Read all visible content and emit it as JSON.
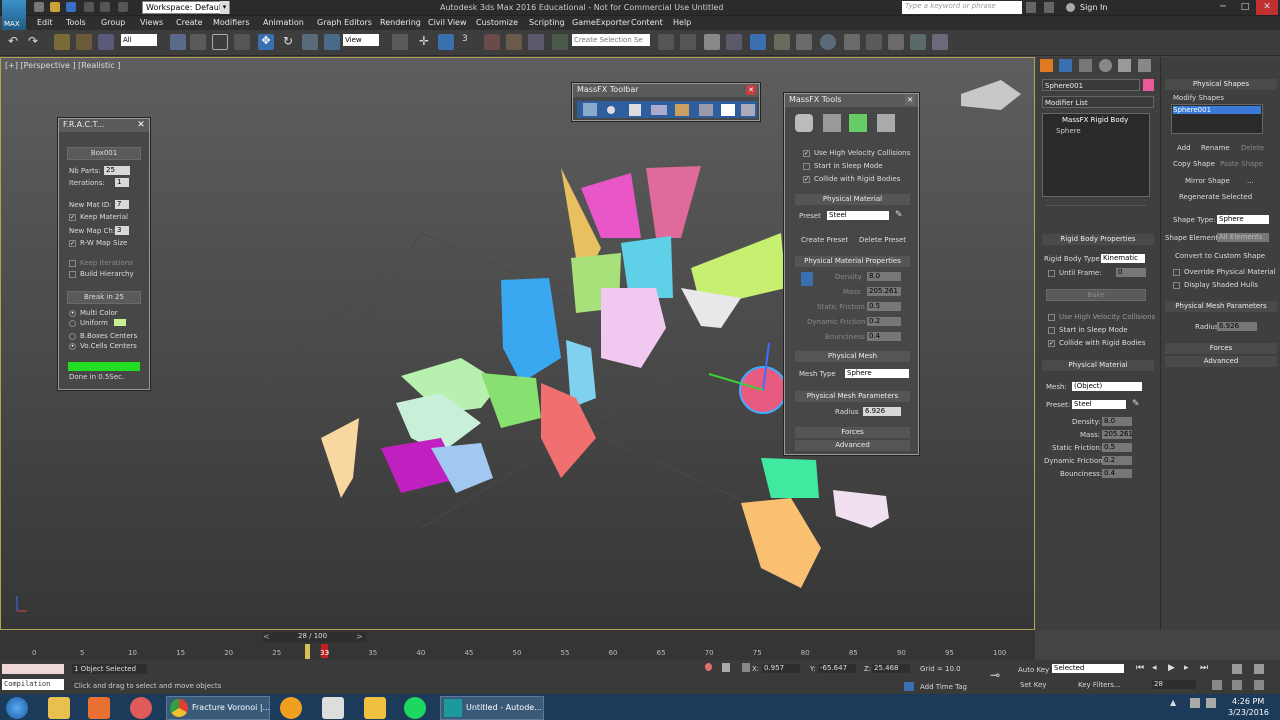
{
  "title_bar": {
    "workspace": "Workspace: Default",
    "title": "Autodesk 3ds Max 2016 Educational - Not for Commercial Use   Untitled",
    "search_placeholder": "Type a keyword or phrase",
    "sign_in": "Sign In",
    "logo": "MAX"
  },
  "menus": [
    "Edit",
    "Tools",
    "Group",
    "Views",
    "Create",
    "Modifiers",
    "Animation",
    "Graph Editors",
    "Rendering",
    "Civil View",
    "Customize",
    "Scripting",
    "GameExporter",
    "Content",
    "Help"
  ],
  "toolbar": {
    "filter": "All",
    "view": "View",
    "selection_set": "Create Selection Se"
  },
  "viewport": {
    "label": "[+] [Perspective ] [Realistic ]"
  },
  "fracture": {
    "title": "F.R.A.C.T...",
    "object": "Box001",
    "nb_parts_label": "Nb Parts:",
    "nb_parts": "25",
    "iterations_label": "Iterations:",
    "iterations": "1",
    "new_mat_id_label": "New Mat ID:",
    "new_mat_id": "7",
    "keep_material": "Keep Material",
    "new_map_ch_label": "New Map Ch:",
    "new_map_ch": "3",
    "rw_map_size": "R-W Map Size",
    "keep_iterations": "Keep Iterations",
    "build_hierarchy": "Build Hierarchy",
    "break_button": "Break in 25",
    "multi_color": "Multi Color",
    "uniform": "Uniform",
    "boxes_centers": "B.Boxes Centers",
    "vo_cells_centers": "Vo.Cells Centers",
    "done": "Done in 0.5Sec.",
    "progress": 1.0
  },
  "massfx_toolbar": {
    "title": "MassFX Toolbar"
  },
  "massfx_tools": {
    "title": "MassFX Tools",
    "use_high_velocity": "Use High Velocity Collisions",
    "start_sleep": "Start in Sleep Mode",
    "collide_rigid": "Collide with Rigid Bodies",
    "physical_material": "Physical Material",
    "preset_label": "Preset",
    "preset": "Steel",
    "create_preset": "Create Preset",
    "delete_preset": "Delete Preset",
    "pm_properties": "Physical Material Properties",
    "density_label": "Density",
    "density": "8.0",
    "mass_label": "Mass",
    "mass": "205.261",
    "static_friction_label": "Static Friction",
    "static_friction": "0.5",
    "dynamic_friction_label": "Dynamic Friction",
    "dynamic_friction": "0.2",
    "bounciness_label": "Bounciness",
    "bounciness": "0.4",
    "physical_mesh": "Physical Mesh",
    "mesh_type_label": "Mesh Type",
    "mesh_type": "Sphere",
    "pm_parameters": "Physical Mesh Parameters",
    "radius_label": "Radius",
    "radius": "6.926",
    "forces": "Forces",
    "advanced": "Advanced"
  },
  "command_panel": {
    "object_name": "Sphere001",
    "modifier_list": "Modifier List",
    "stack": [
      "MassFX Rigid Body",
      "Sphere"
    ],
    "rbp_title": "Rigid Body Properties",
    "rb_type_label": "Rigid Body Type:",
    "rb_type": "Kinematic",
    "until_frame": "Until Frame:",
    "until_frame_val": "0",
    "bake": "Bake",
    "use_high_velocity": "Use High Velocity Collisions",
    "start_sleep": "Start in Sleep Mode",
    "collide_rigid": "Collide with Rigid Bodies",
    "pm_title": "Physical Material",
    "mesh_label": "Mesh:",
    "mesh": "(Object)",
    "preset_label": "Preset:",
    "preset": "Steel",
    "density_label": "Density:",
    "density": "8.0",
    "mass_label": "Mass:",
    "mass": "205.261",
    "static_friction_label": "Static Friction:",
    "static_friction": "0.5",
    "dynamic_friction_label": "Dynamic Friction:",
    "dynamic_friction": "0.2",
    "bounciness_label": "Bounciness:",
    "bounciness": "0.4"
  },
  "right_panel": {
    "physical_shapes": "Physical Shapes",
    "modify_shapes": "Modify Shapes",
    "shape_item": "Sphere001",
    "add": "Add",
    "rename": "Rename",
    "delete": "Delete",
    "copy_shape": "Copy Shape",
    "paste_shape": "Paste Shape",
    "mirror_shape": "Mirror Shape",
    "more": "...",
    "regenerate": "Regenerate Selected",
    "shape_type_label": "Shape Type:",
    "shape_type": "Sphere",
    "shape_element_label": "Shape Element:",
    "shape_element": "All Elements",
    "convert": "Convert to Custom Shape",
    "override": "Override Physical Material",
    "display_hulls": "Display Shaded Hulls",
    "pmp_title": "Physical Mesh Parameters",
    "radius_label": "Radius:",
    "radius": "6.926",
    "forces": "Forces",
    "advanced": "Advanced"
  },
  "timeline": {
    "frame": "28 / 100",
    "ticks": [
      "0",
      "5",
      "10",
      "15",
      "20",
      "25",
      "30",
      "35",
      "40",
      "45",
      "50",
      "55",
      "60",
      "65",
      "70",
      "75",
      "80",
      "85",
      "90",
      "95",
      "100"
    ],
    "key_frame": "33",
    "current_frame_fraction": 0.28
  },
  "status": {
    "selected": "1 Object Selected",
    "hint": "Click and drag to select and move objects",
    "compilation": "Compilation",
    "x_label": "X:",
    "x": "0.957",
    "y_label": "Y:",
    "y": "-65.647",
    "z_label": "Z:",
    "z": "25.468",
    "grid": "Grid = 10.0",
    "auto_key": "Auto Key",
    "auto_key_value": "Selected",
    "set_key": "Set Key",
    "key_filters": "Key Filters...",
    "current_frame": "28",
    "add_time_tag": "Add Time Tag"
  },
  "taskbar": {
    "items": [
      "Fracture Voronoi |...",
      "Untitled - Autode..."
    ],
    "time": "4:26 PM",
    "date": "3/23/2016"
  }
}
